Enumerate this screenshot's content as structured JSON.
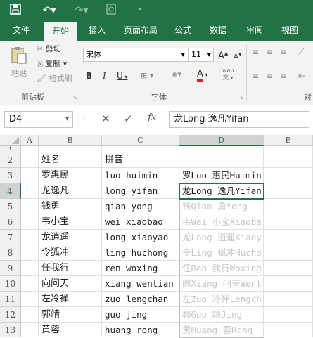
{
  "quick_access": {
    "save_icon": "save-icon",
    "undo_icon": "undo-icon",
    "redo_icon": "redo-icon",
    "customize_icon": "customize-icon"
  },
  "ribbon_tabs": [
    "文件",
    "开始",
    "插入",
    "页面布局",
    "公式",
    "数据",
    "审阅",
    "视图"
  ],
  "active_tab": "开始",
  "clipboard": {
    "paste": "粘贴",
    "cut": "剪切",
    "copy": "复制",
    "format_painter": "格式刷",
    "group_label": "剪贴板"
  },
  "font": {
    "name": "宋体",
    "size": "11",
    "bold": "B",
    "italic": "I",
    "underline": "U",
    "group_label": "字体",
    "grow": "A",
    "shrink": "A",
    "wen": "wén",
    "font_color": "A"
  },
  "extra_group_label": "对",
  "name_box": "D4",
  "formula_value": "龙Long 逸凡Yifan",
  "formula_buttons": {
    "cancel": "✕",
    "enter": "✓",
    "fx": "fx"
  },
  "columns": [
    "A",
    "B",
    "C",
    "D",
    "E"
  ],
  "selected_column": "D",
  "rows": [
    "1",
    "2",
    "3",
    "4",
    "5",
    "6",
    "7",
    "8",
    "9",
    "10",
    "11",
    "12",
    "13"
  ],
  "selected_row": "4",
  "cells": [
    {
      "row": "2",
      "B": "姓名",
      "C": "拼音",
      "D": ""
    },
    {
      "row": "3",
      "B": "罗惠民",
      "C": "luo huimin",
      "D": "罗Luo 惠民Huimin"
    },
    {
      "row": "4",
      "B": "龙逸凡",
      "C": "long yifan",
      "D": "龙Long 逸凡Yifan"
    },
    {
      "row": "5",
      "B": "钱勇",
      "C": "qian yong",
      "D": "钱Qian 勇Yong"
    },
    {
      "row": "6",
      "B": "韦小宝",
      "C": "wei xiaobao",
      "D": "韦Wei 小宝Xiaoba"
    },
    {
      "row": "7",
      "B": "龙逍遥",
      "C": "long xiaoyao",
      "D": "龙Long 逍遥Xiaoy"
    },
    {
      "row": "8",
      "B": "令狐冲",
      "C": "ling huchong",
      "D": "令Ling 狐冲Hucho"
    },
    {
      "row": "9",
      "B": "任我行",
      "C": "ren woxing",
      "D": "任Ren 我行Woxing"
    },
    {
      "row": "10",
      "B": "向问天",
      "C": "xiang wentian",
      "D": "向Xiang 问天Went"
    },
    {
      "row": "11",
      "B": "左冷禅",
      "C": "zuo lengchan",
      "D": "左Zuo 冷禅Lengch"
    },
    {
      "row": "12",
      "B": "郭靖",
      "C": "guo jing",
      "D": "郭Guo 靖Jing"
    },
    {
      "row": "13",
      "B": "黄蓉",
      "C": "huang rong",
      "D": "黄Huang 蓉Rong"
    }
  ],
  "colors": {
    "excel_green": "#217346",
    "ribbon_bg": "#f3f3f3",
    "preview_text": "#c6c6c6"
  }
}
